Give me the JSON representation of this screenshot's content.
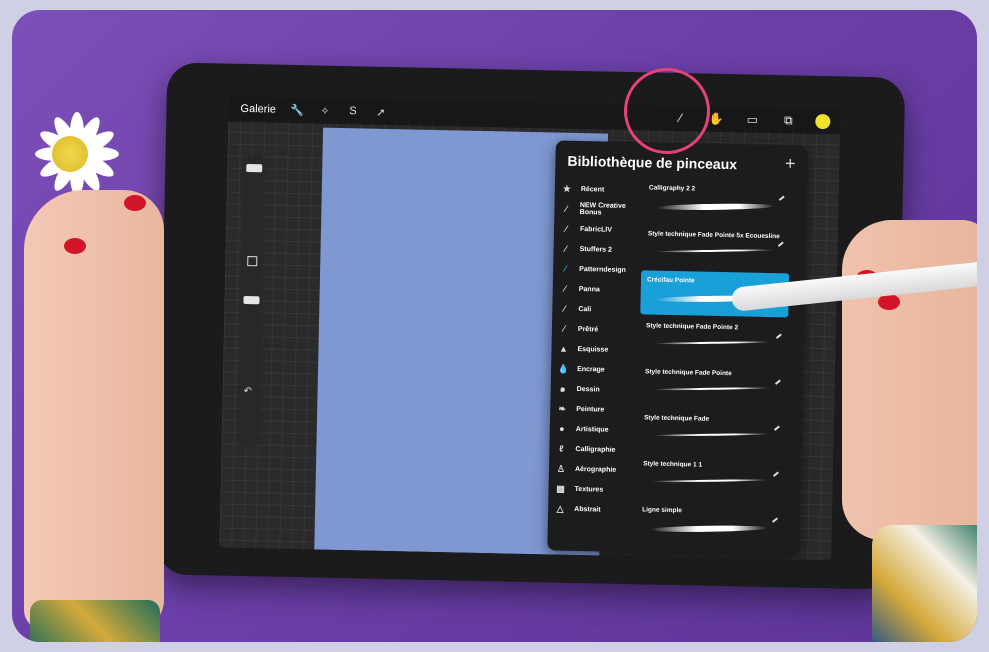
{
  "app": {
    "gallery_label": "Galerie",
    "color_swatch": "#f2e12b",
    "accent_color": "#1aa0d8",
    "highlight_circle_color": "#e8407a"
  },
  "toolbar": {
    "left_icons": [
      "wrench-icon",
      "magic-wand-icon",
      "selection-s-icon",
      "move-arrow-icon"
    ],
    "right_icons": [
      "brush-icon",
      "smudge-icon",
      "eraser-icon",
      "layers-icon",
      "color-dot"
    ]
  },
  "panel": {
    "title": "Bibliothèque de pinceaux",
    "add_label": "+",
    "categories": [
      {
        "label": "Récent",
        "icon": "star-icon"
      },
      {
        "label": "NEW Creative Bonus",
        "icon": "brush-stroke-icon"
      },
      {
        "label": "FabricLIV",
        "icon": "brush-stroke-icon"
      },
      {
        "label": "Stuffers 2",
        "icon": "brush-stroke-icon"
      },
      {
        "label": "Patterndesign",
        "icon": "brush-stroke-icon",
        "active": true
      },
      {
        "label": "Panna",
        "icon": "brush-stroke-icon"
      },
      {
        "label": "Cali",
        "icon": "brush-stroke-icon"
      },
      {
        "label": "Prêtré",
        "icon": "brush-stroke-icon"
      },
      {
        "label": "Esquisse",
        "icon": "pencil-icon"
      },
      {
        "label": "Encrage",
        "icon": "ink-drop-icon"
      },
      {
        "label": "Dessin",
        "icon": "spiral-icon"
      },
      {
        "label": "Peinture",
        "icon": "paint-brush-icon"
      },
      {
        "label": "Artistique",
        "icon": "palette-icon"
      },
      {
        "label": "Calligraphie",
        "icon": "calligraphy-icon"
      },
      {
        "label": "Aérographie",
        "icon": "airbrush-icon"
      },
      {
        "label": "Textures",
        "icon": "grid-icon"
      },
      {
        "label": "Abstrait",
        "icon": "triangle-icon"
      }
    ],
    "brushes": [
      {
        "name": "Calligraphy 2 2"
      },
      {
        "name": "Style technique Fade Pointe 5x Ecouesline"
      },
      {
        "name": "Crécifau Pointe",
        "selected": true
      },
      {
        "name": "Style technique Fade Pointe 2"
      },
      {
        "name": "Style technique Fade Pointe"
      },
      {
        "name": "Style technique Fade"
      },
      {
        "name": "Style technique 1 1"
      },
      {
        "name": "Ligne simple"
      }
    ]
  }
}
